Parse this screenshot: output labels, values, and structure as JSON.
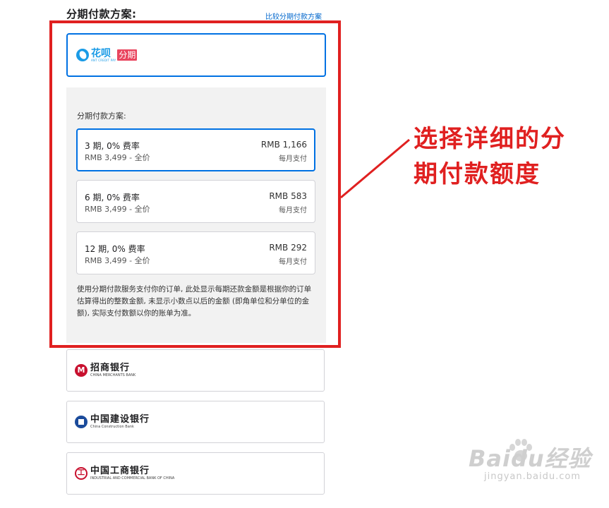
{
  "header": {
    "title": "分期付款方案:",
    "compare_link": "比较分期付款方案"
  },
  "huabei": {
    "brand": "花呗",
    "brand_sub": "ANT CREDIT PAY",
    "badge": "分期",
    "brand_color": "#1a9be6",
    "badge_color": "#e9465f"
  },
  "plans": {
    "label": "分期付款方案:",
    "options": [
      {
        "term": "3 期, 0% 费率",
        "monthly_price": "RMB 1,166",
        "total": "RMB 3,499 - 全价",
        "period": "每月支付",
        "selected": true
      },
      {
        "term": "6 期, 0% 费率",
        "monthly_price": "RMB 583",
        "total": "RMB 3,499 - 全价",
        "period": "每月支付",
        "selected": false
      },
      {
        "term": "12 期, 0% 费率",
        "monthly_price": "RMB 292",
        "total": "RMB 3,499 - 全价",
        "period": "每月支付",
        "selected": false
      }
    ],
    "disclaimer": "使用分期付款服务支付你的订单, 此处显示每期还款金额是根据你的订单估算得出的整数金额, 未显示小数点以后的金额 (即角单位和分单位的金额), 实际支付数额以你的账单为准。",
    "selected_color": "#0071e3"
  },
  "annotation": {
    "text_line1": "选择详细的分",
    "text_line2": "期付款额度",
    "color": "#e02020"
  },
  "banks": [
    {
      "name": "招商银行",
      "sub": "CHINA MERCHANTS BANK",
      "icon": "cmb-logo-icon"
    },
    {
      "name": "中国建设银行",
      "sub": "China Construction Bank",
      "icon": "ccb-logo-icon"
    },
    {
      "name": "中国工商银行",
      "sub": "INDUSTRIAL AND COMMERCIAL BANK OF CHINA",
      "icon": "icbc-logo-icon"
    }
  ],
  "watermark": {
    "main": "Baidu经验",
    "sub": "jingyan.baidu.com"
  }
}
